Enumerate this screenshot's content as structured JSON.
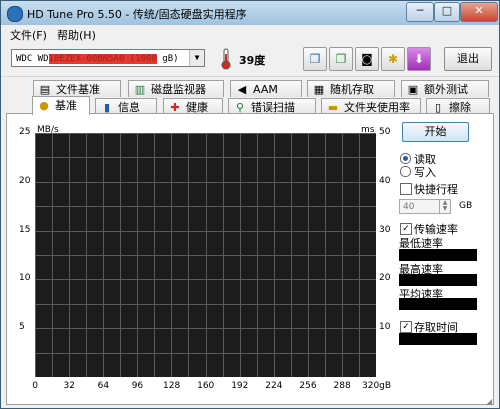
{
  "window": {
    "title": "HD Tune Pro 5.50 - 传统/固态硬盘实用程序"
  },
  "window_controls": {
    "minimize": "─",
    "maximize": "□",
    "close": "✕"
  },
  "menu": [
    "文件(F)",
    "帮助(H)"
  ],
  "toolbar": {
    "drive_prefix": "WDC WD",
    "drive_redacted": "10EZEX-00BN5A0 (1000",
    "drive_suffix": " gB)",
    "temperature": "39度",
    "exit_label": "退出"
  },
  "tabs_top": [
    {
      "label": "文件基准",
      "icon": "file-icon"
    },
    {
      "label": "磁盘监视器",
      "icon": "chart-icon"
    },
    {
      "label": "AAM",
      "icon": "speaker-icon"
    },
    {
      "label": "随机存取",
      "icon": "document-icon"
    },
    {
      "label": "额外测试",
      "icon": "test-icon"
    }
  ],
  "tabs_bottom": [
    {
      "label": "基准",
      "icon": "benchmark-icon"
    },
    {
      "label": "信息",
      "icon": "info-icon"
    },
    {
      "label": "健康",
      "icon": "health-cross-icon"
    },
    {
      "label": "错误扫描",
      "icon": "magnifier-icon"
    },
    {
      "label": "文件夹使用率",
      "icon": "folder-icon"
    },
    {
      "label": "擦除",
      "icon": "trash-icon"
    }
  ],
  "chart_data": {
    "type": "line",
    "y_left_unit": "MB/s",
    "y_right_unit": "ms",
    "y_left_ticks": [
      "25",
      "20",
      "15",
      "10",
      "5"
    ],
    "y_right_ticks": [
      "50",
      "40",
      "30",
      "20",
      "10"
    ],
    "x_ticks": [
      "0",
      "32",
      "64",
      "96",
      "128",
      "160",
      "192",
      "224",
      "256",
      "288",
      "320gB"
    ],
    "ylim_left": [
      0,
      25
    ],
    "ylim_right": [
      0,
      50
    ],
    "xlim": [
      0,
      320
    ],
    "grid": true,
    "series": []
  },
  "panel": {
    "start_label": "开始",
    "read_label": "读取",
    "write_label": "写入",
    "short_stroke_label": "快捷行程",
    "short_stroke_value": "40",
    "short_stroke_unit": "GB",
    "transfer_rate_label": "传输速率",
    "min_label": "最低速率",
    "max_label": "最高速率",
    "avg_label": "平均速率",
    "access_time_label": "存取时间",
    "checked_mark": "✓"
  }
}
